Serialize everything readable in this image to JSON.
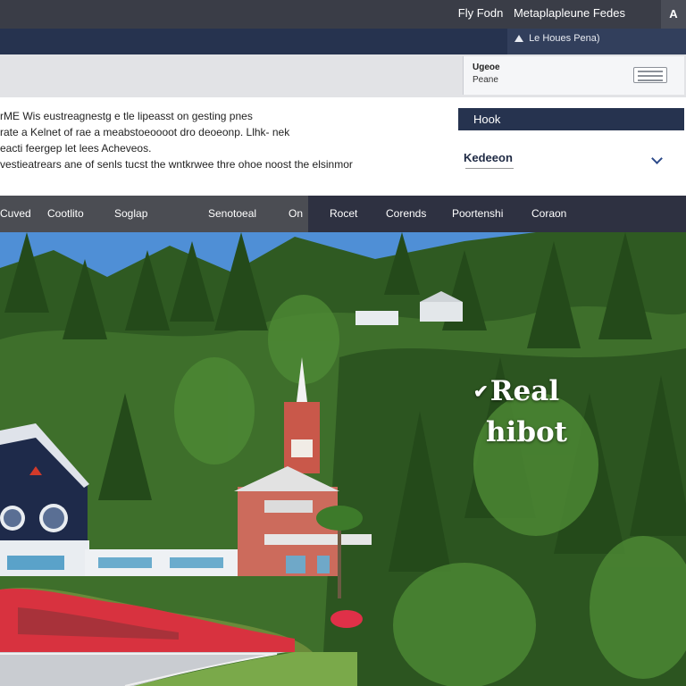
{
  "topbar": {
    "links": [
      "Fly Fodn",
      "Metaplapleune Fedes"
    ],
    "account_icon": "A"
  },
  "navstrip": {
    "dropdown_label": "Le Houes Pena)"
  },
  "infobox": {
    "line1": "Ugeoe",
    "line2": "Peane"
  },
  "content": {
    "description": [
      "rME Wis eustreagnestg e tle lipeasst on gesting pnes",
      "rate a Kelnet of rae a meabstoeoooot dro deoeonp. Llhk- nek",
      "eacti feergep let lees Acheveos.",
      "vestieatrears ane of senls tucst the wntkrwee thre ohoe noost the elsinmor"
    ],
    "book_button": "Hook",
    "select_value": "Kedeeon"
  },
  "mainnav": {
    "items": [
      "Cuved",
      "Cootlito",
      "Soglap",
      "Senotoeal",
      "On",
      "Rocet",
      "Corends",
      "Poortenshi",
      "Coraon"
    ]
  },
  "hero": {
    "title_line1": "Real",
    "title_line2": "hibot"
  },
  "colors": {
    "navy": "#26334f",
    "dark_bar": "#3a3d47",
    "gray_nav": "#4b4d53",
    "forest": "#3d6a2c"
  },
  "icons": [
    "account-icon",
    "triangle-up-icon",
    "card-icon",
    "chevron-down-icon",
    "check-icon"
  ]
}
